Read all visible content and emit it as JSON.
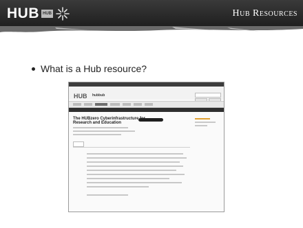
{
  "header": {
    "logo_text": "HUB",
    "logo_badge": "HUB",
    "title": "Hub Resources"
  },
  "content": {
    "bullet_text": "What is a Hub resource?"
  },
  "screenshot": {
    "site_logo": "HUB",
    "site_name": "hubbub",
    "resource_title_line1": "The HUBzero Cyberinfrastructure for",
    "resource_title_line2": "Research and Education"
  },
  "colors": {
    "header_bg": "#2a2a2a",
    "stroke": "#8a8a8a"
  }
}
